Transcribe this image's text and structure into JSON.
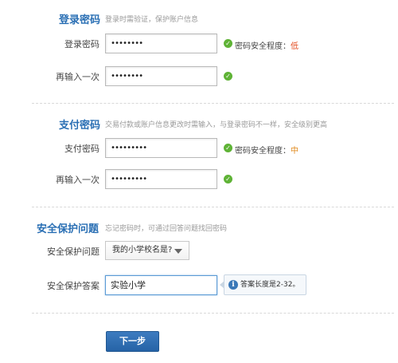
{
  "login_section": {
    "title": "登录密码",
    "hint": "登录时需验证，保护账户信息",
    "password_label": "登录密码",
    "password_value": "••••••••",
    "strength_label": "密码安全程度：",
    "strength_value": "低",
    "confirm_label": "再输入一次",
    "confirm_value": "••••••••"
  },
  "payment_section": {
    "title": "支付密码",
    "hint": "交易付款或账户信息更改时需输入，与登录密码不一样，安全级别更高",
    "password_label": "支付密码",
    "password_value": "•••••••••",
    "strength_label": "密码安全程度：",
    "strength_value": "中",
    "confirm_label": "再输入一次",
    "confirm_value": "•••••••••"
  },
  "security_section": {
    "title": "安全保护问题",
    "hint": "忘记密码时，可通过回答问题找回密码",
    "question_label": "安全保护问题",
    "question_selected": "我的小学校名是?",
    "answer_label": "安全保护答案",
    "answer_value": "实验小学",
    "answer_tip": "答案长度是2-32。"
  },
  "next_button": "下一步",
  "icons": {
    "ok": "check-icon",
    "info": "info-icon",
    "dropdown": "chevron-down-icon"
  },
  "colors": {
    "section_title": "#2a6fb4",
    "ok_green": "#5fb336",
    "strength_low": "#e2481c",
    "strength_mid": "#e08a1c",
    "button_blue": "#2d6db1"
  }
}
